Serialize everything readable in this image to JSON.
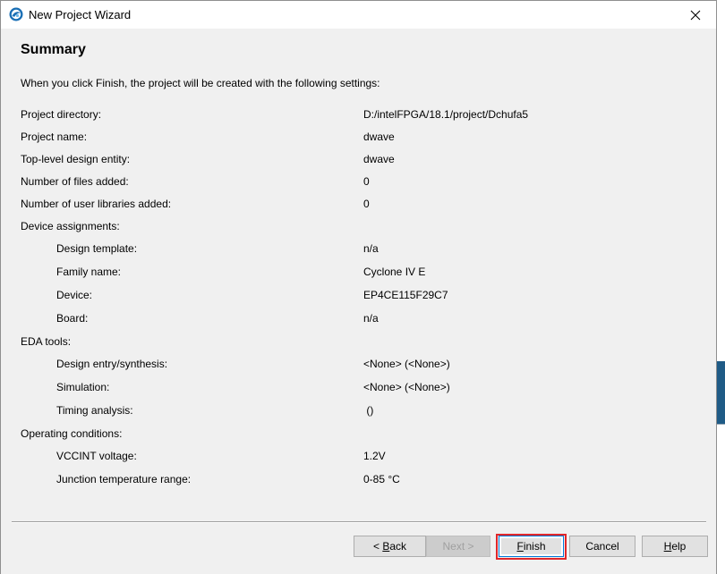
{
  "window": {
    "title": "New Project Wizard"
  },
  "summary": {
    "heading": "Summary",
    "intro": "When you click Finish, the project will be created with the following settings:"
  },
  "rows": [
    {
      "label": "Project directory:",
      "value": "D:/intelFPGA/18.1/project/Dchufa5",
      "indent": false
    },
    {
      "label": "Project name:",
      "value": "dwave",
      "indent": false
    },
    {
      "label": "Top-level design entity:",
      "value": "dwave",
      "indent": false
    },
    {
      "label": "Number of files added:",
      "value": "0",
      "indent": false
    },
    {
      "label": "Number of user libraries added:",
      "value": "0",
      "indent": false
    },
    {
      "label": "Device assignments:",
      "value": "",
      "indent": false
    },
    {
      "label": "Design template:",
      "value": "n/a",
      "indent": true
    },
    {
      "label": "Family name:",
      "value": "Cyclone IV E",
      "indent": true
    },
    {
      "label": "Device:",
      "value": "EP4CE115F29C7",
      "indent": true
    },
    {
      "label": "Board:",
      "value": "n/a",
      "indent": true
    },
    {
      "label": "EDA tools:",
      "value": "",
      "indent": false
    },
    {
      "label": "Design entry/synthesis:",
      "value": "<None> (<None>)",
      "indent": true
    },
    {
      "label": "Simulation:",
      "value": "<None> (<None>)",
      "indent": true
    },
    {
      "label": "Timing analysis:",
      "value": " ()",
      "indent": true
    },
    {
      "label": "Operating conditions:",
      "value": "",
      "indent": false
    },
    {
      "label": "VCCINT voltage:",
      "value": "1.2V",
      "indent": true
    },
    {
      "label": "Junction temperature range:",
      "value": "0-85 °C",
      "indent": true
    }
  ],
  "buttons": {
    "back": {
      "prefix": "< ",
      "mnemonic": "B",
      "rest": "ack"
    },
    "next": {
      "label": "Next >"
    },
    "finish": {
      "mnemonic": "F",
      "rest": "inish"
    },
    "cancel": {
      "label": "Cancel"
    },
    "help": {
      "mnemonic": "H",
      "rest": "elp"
    }
  },
  "colors": {
    "highlight_outline": "#e0262a",
    "focus_border": "#0078d7"
  }
}
